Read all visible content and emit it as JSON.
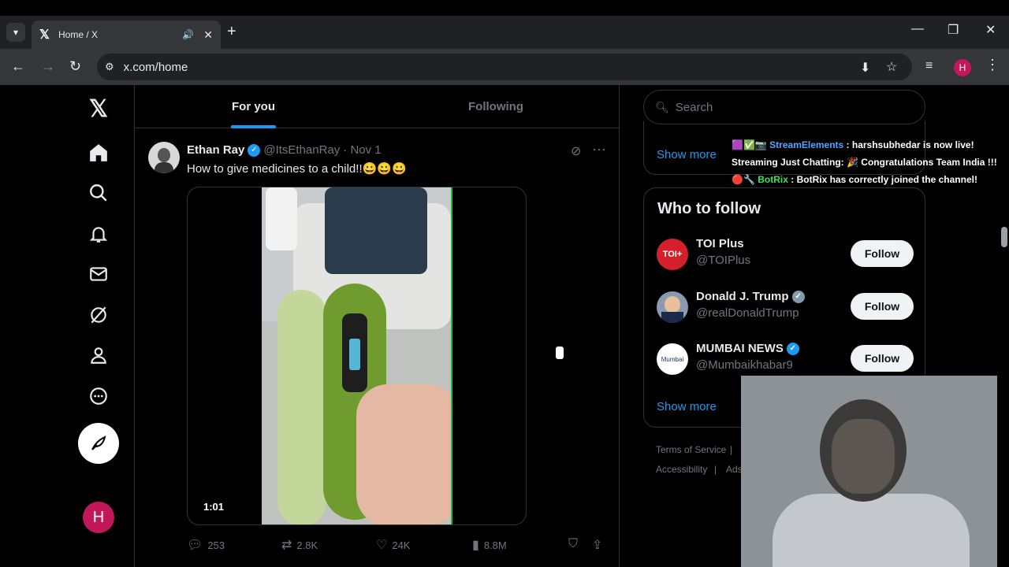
{
  "browser": {
    "tab_title": "Home / X",
    "tab_logo": "𝕏",
    "url": "x.com/home",
    "avatar_letter": "H"
  },
  "nav": {
    "logo": "𝕏",
    "avatar_letter": "H"
  },
  "feed": {
    "tabs": [
      "For you",
      "Following"
    ],
    "active_tab": "For you",
    "post": {
      "name": "Ethan Ray",
      "handle": "@ItsEthanRay",
      "date": "· Nov 1",
      "text": "How to give medicines to a child!!😀😀😀",
      "video_time": "1:01",
      "replies": "253",
      "reposts": "2.8K",
      "likes": "24K",
      "views": "8.8M"
    }
  },
  "sidebar": {
    "search_placeholder": "Search",
    "show_more_1": "Show more",
    "who_to_follow_title": "Who to follow",
    "accounts": [
      {
        "name": "TOI Plus",
        "handle": "@TOIPlus",
        "follow": "Follow",
        "avatar_text": "TOI+",
        "avatar_color": "#d4202a",
        "verified": false
      },
      {
        "name": "Donald J. Trump",
        "handle": "@realDonaldTrump",
        "follow": "Follow",
        "avatar_text": "",
        "avatar_color": "#8a9bb0",
        "verified": true
      },
      {
        "name": "MUMBAI NEWS",
        "handle": "@Mumbaikhabar9",
        "follow": "Follow",
        "avatar_text": "Mumbai",
        "avatar_color": "#ffffff",
        "verified": true
      }
    ],
    "show_more_2": "Show more",
    "footer_1": "Terms of Service",
    "footer_sep": "|",
    "footer_2": "Accessibility",
    "footer_3": "Ads"
  },
  "stream_overlay": {
    "line1_icons": "🟪✅📷",
    "line1_name": "StreamElements",
    "line1_msg": " : harshsubhedar is now live!",
    "line2": "Streaming Just Chatting: 🎉 Congratulations Team India !!!",
    "line3_icons": "🔴🔧",
    "line3_name": "BotRix",
    "line3_msg": " : BotRix has correctly joined the channel!"
  },
  "colors": {
    "accent": "#1d9bf0",
    "background": "#000000",
    "text": "#e7e9ea",
    "muted": "#71767b"
  }
}
